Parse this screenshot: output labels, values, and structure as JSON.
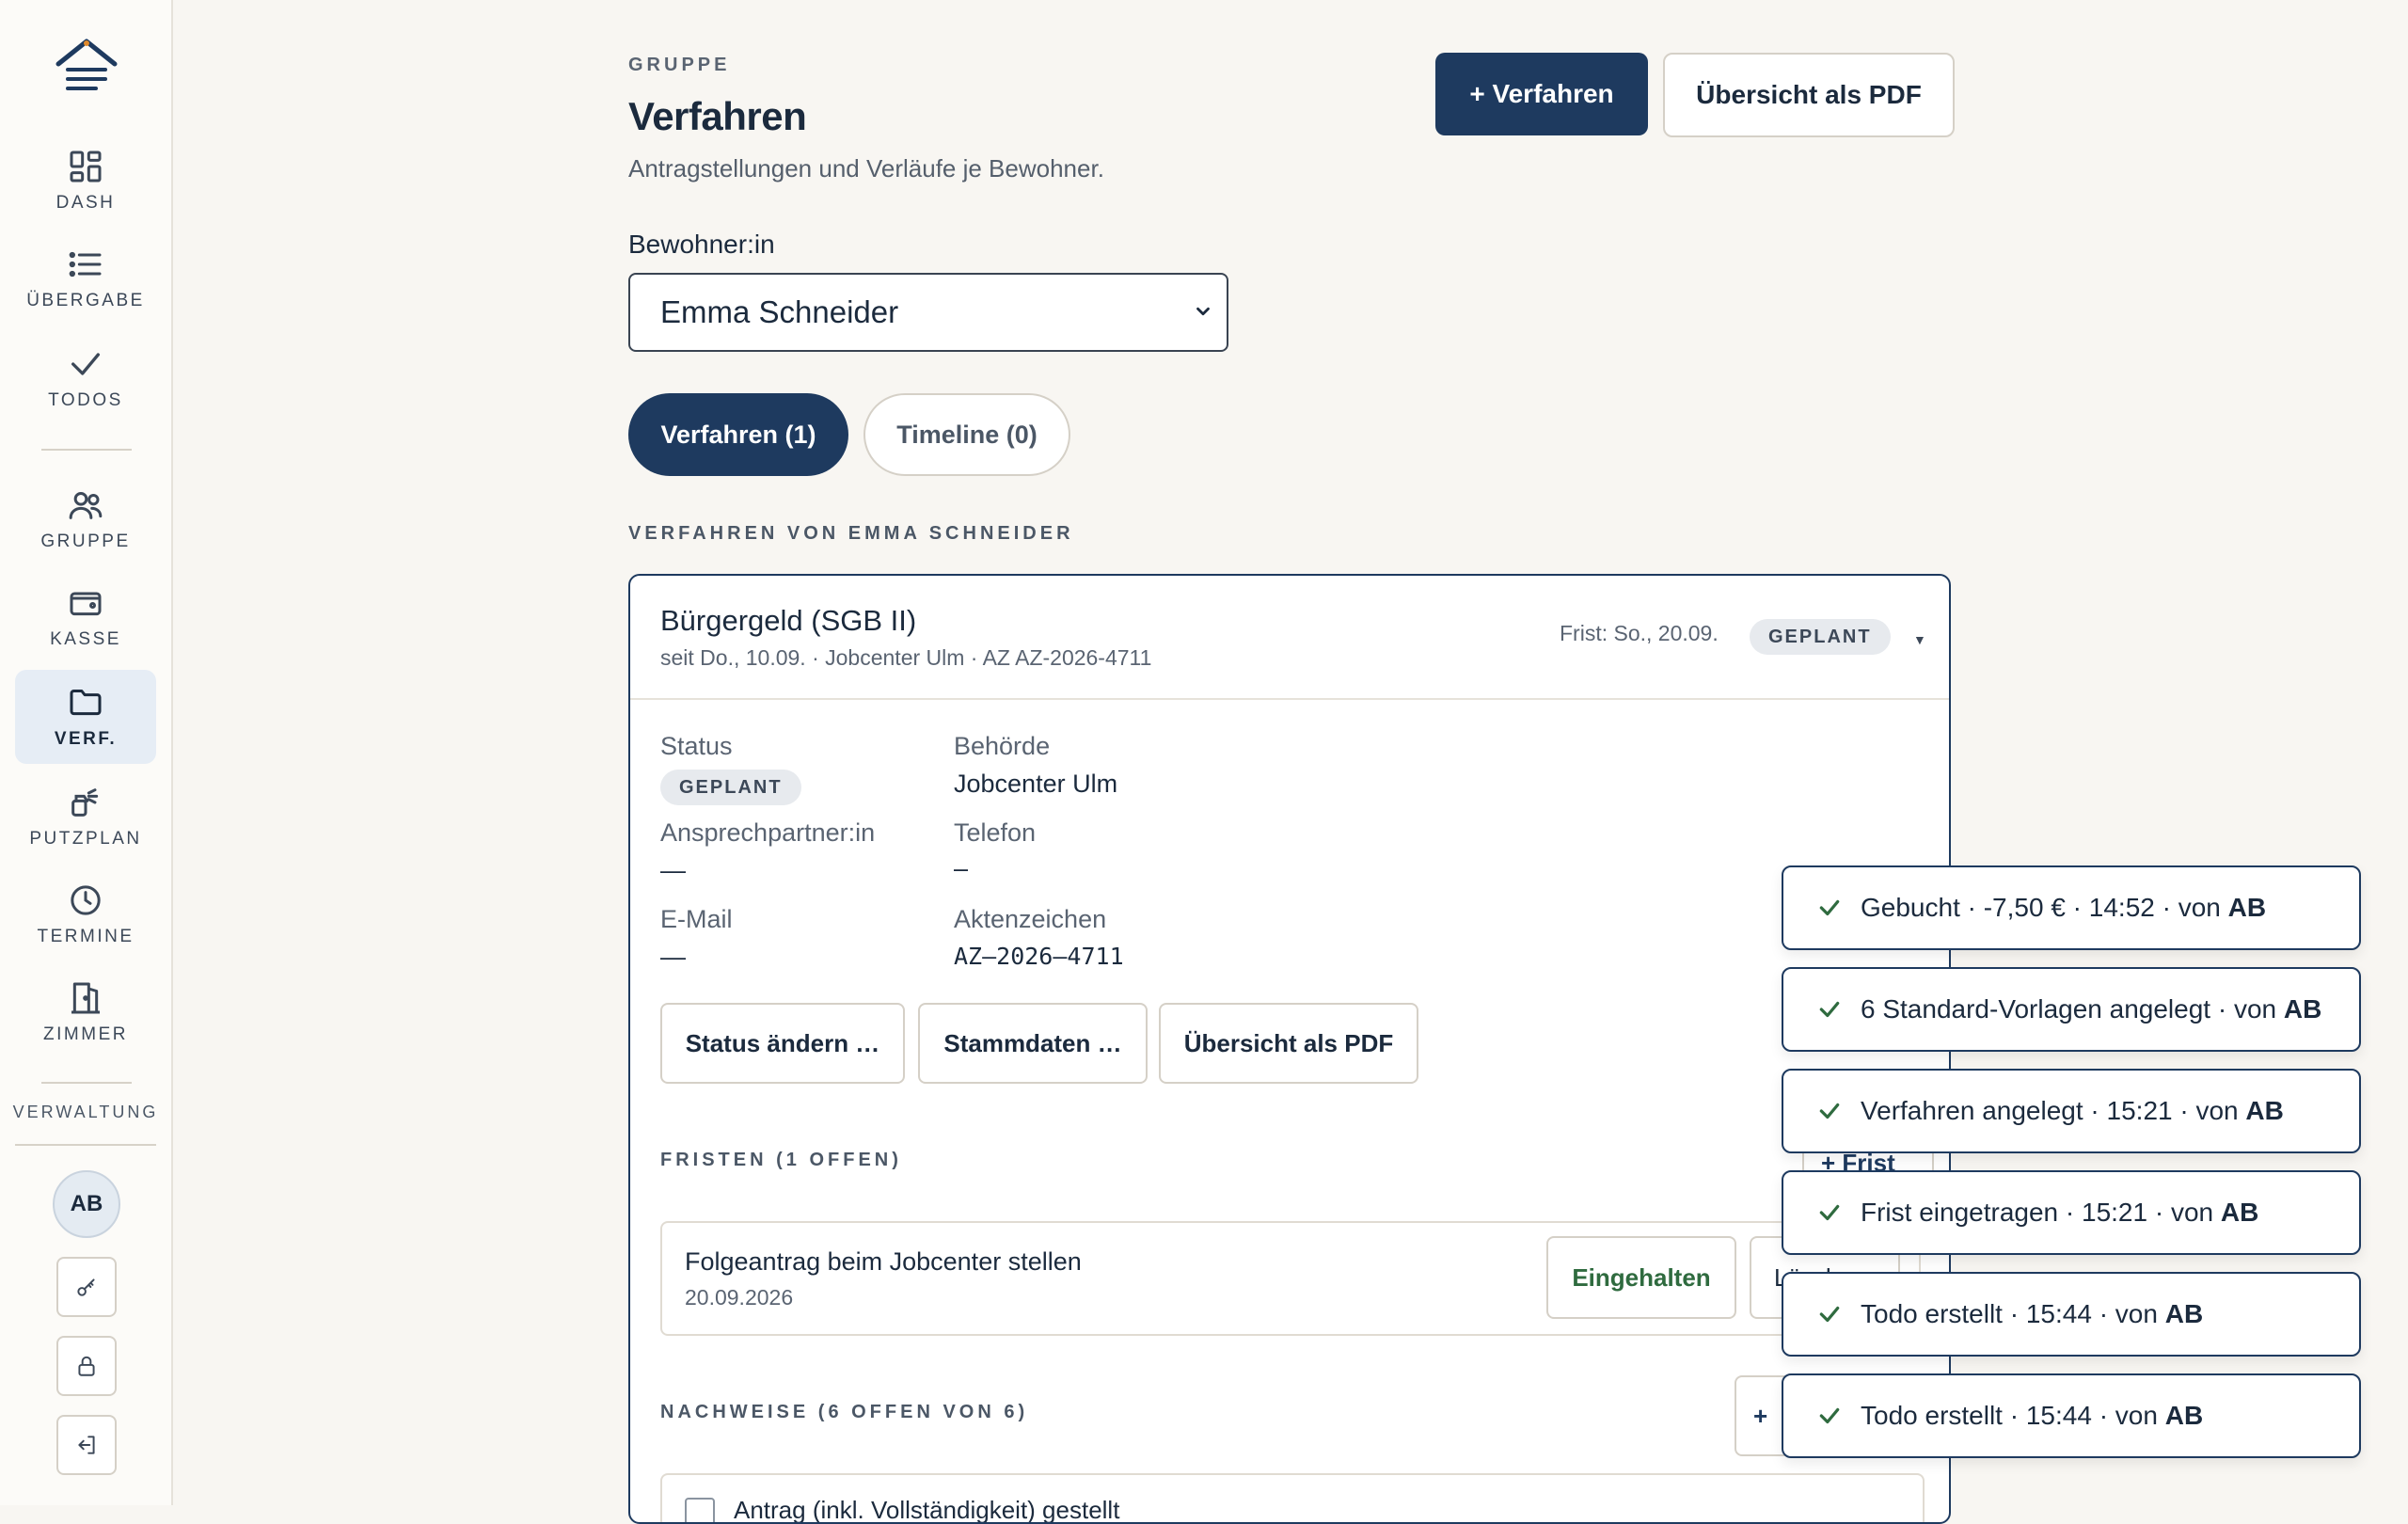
{
  "sidebar": {
    "items": [
      {
        "label": "DASH",
        "icon": "grid-icon"
      },
      {
        "label": "ÜBERGABE",
        "icon": "list-icon"
      },
      {
        "label": "TODOS",
        "icon": "check-icon"
      },
      {
        "label": "GRUPPE",
        "icon": "users-icon"
      },
      {
        "label": "KASSE",
        "icon": "wallet-icon"
      },
      {
        "label": "VERF.",
        "icon": "folder-icon",
        "active": true
      },
      {
        "label": "PUTZPLAN",
        "icon": "spray-icon"
      },
      {
        "label": "TERMINE",
        "icon": "clock-icon"
      },
      {
        "label": "ZIMMER",
        "icon": "door-icon"
      }
    ],
    "verwaltung_label": "VERWALTUNG",
    "avatar_initials": "AB"
  },
  "header": {
    "eyebrow": "GRUPPE",
    "title": "Verfahren",
    "subtitle": "Antragstellungen und Verläufe je Bewohner.",
    "new_button": "+ Verfahren",
    "pdf_button": "Übersicht als PDF"
  },
  "resident": {
    "label": "Bewohner:in",
    "selected": "Emma Schneider"
  },
  "tabs": [
    {
      "label": "Verfahren (1)",
      "active": true
    },
    {
      "label": "Timeline (0)",
      "active": false
    }
  ],
  "section_title": "VERFAHREN VON EMMA SCHNEIDER",
  "case": {
    "title": "Bürgergeld (SGB II)",
    "subtitle": "seit Do., 10.09. · Jobcenter Ulm · AZ AZ-2026-4711",
    "deadline": "Frist: So., 20.09.",
    "status_badge": "GEPLANT",
    "fields": {
      "status_label": "Status",
      "status_value": "GEPLANT",
      "behoerde_label": "Behörde",
      "behoerde_value": "Jobcenter Ulm",
      "ansprech_label": "Ansprechpartner:in",
      "ansprech_value": "—",
      "telefon_label": "Telefon",
      "telefon_value": "–",
      "email_label": "E-Mail",
      "email_value": "—",
      "az_label": "Aktenzeichen",
      "az_value": "AZ–2026–4711"
    },
    "actions": {
      "status": "Status ändern …",
      "stammdaten": "Stammdaten …",
      "pdf": "Übersicht als PDF"
    },
    "fristen_head": "FRISTEN (1 OFFEN)",
    "frist_add": "+ Frist",
    "frist_item": {
      "title": "Folgeantrag beim Jobcenter stellen",
      "date": "20.09.2026",
      "done_button": "Eingehalten",
      "delete_button": "Löschen"
    },
    "nachweise_head": "NACHWEISE (6 OFFEN VON 6)",
    "nachweis_add": "+",
    "nachweis_first": "Antrag (inkl. Vollständigkeit) gestellt"
  },
  "toasts": [
    {
      "text": "Gebucht · -7,50 € · 14:52 · von ",
      "user": "AB"
    },
    {
      "text": "6 Standard-Vorlagen angelegt · von ",
      "user": "AB"
    },
    {
      "text": "Verfahren angelegt · 15:21 · von ",
      "user": "AB"
    },
    {
      "text": "Frist eingetragen · 15:21 · von ",
      "user": "AB"
    },
    {
      "text": "Todo erstellt · 15:44 · von ",
      "user": "AB"
    },
    {
      "text": "Todo erstellt · 15:44 · von ",
      "user": "AB"
    }
  ],
  "colors": {
    "primary": "#1e3a5f",
    "background": "#f8f6f2",
    "success": "#2f6b3f"
  }
}
